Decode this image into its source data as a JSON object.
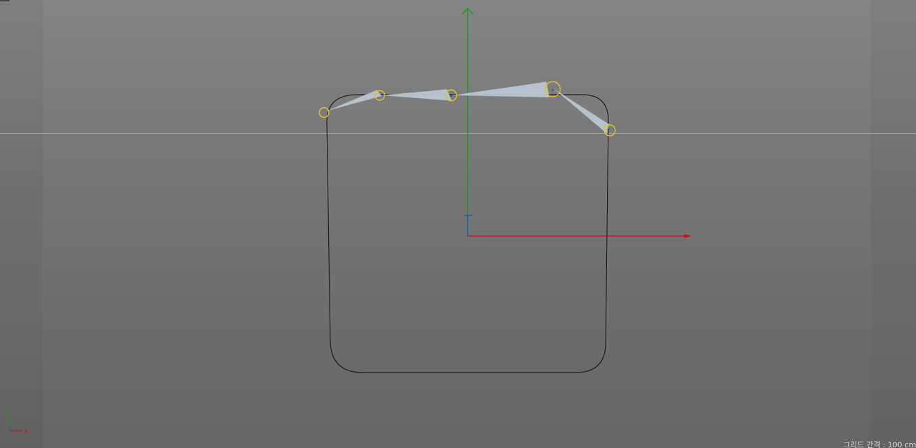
{
  "viewport": {
    "status": {
      "grid_spacing": "그리드 간격 : 100 cm"
    },
    "mini_axis": {
      "y_label": "Y",
      "x_label": "X"
    },
    "colors": {
      "x_axis": "#c01818",
      "y_axis": "#1a9a1a",
      "z_axis": "#1a5ab0",
      "horizon_line": "#a8a8a8",
      "spline": "#1e1e1e",
      "joint_ring": "#e8c020",
      "bone_fill": "#bcc6d2"
    },
    "objects": {
      "spline_shape": "rounded-rectangle-icon",
      "joint_chain_count": 5,
      "joints": [
        "joint-icon",
        "joint-icon",
        "joint-icon",
        "joint-icon",
        "joint-icon"
      ],
      "bones": [
        "bone-icon",
        "bone-icon",
        "bone-icon",
        "bone-icon"
      ]
    }
  }
}
